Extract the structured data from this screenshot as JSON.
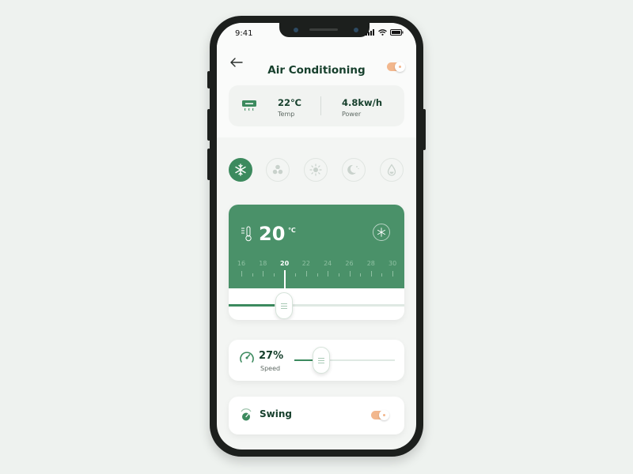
{
  "status_bar": {
    "time": "9:41"
  },
  "header": {
    "title": "Air Conditioning",
    "power_toggle": "on"
  },
  "info": {
    "temp_value": "22℃",
    "temp_label": "Temp",
    "power_value": "4.8kw/h",
    "power_label": "Power"
  },
  "modes": [
    {
      "icon": "snowflake-icon",
      "active": true
    },
    {
      "icon": "fan-icon",
      "active": false
    },
    {
      "icon": "sun-icon",
      "active": false
    },
    {
      "icon": "moon-icon",
      "active": false
    },
    {
      "icon": "water-drop-icon",
      "active": false
    }
  ],
  "temperature": {
    "value": "20",
    "unit": "℃",
    "scale": [
      "16",
      "18",
      "20",
      "22",
      "24",
      "26",
      "28",
      "30"
    ],
    "selected": "20"
  },
  "speed": {
    "value": "27%",
    "label": "Speed",
    "level": 0.27
  },
  "swing": {
    "label": "Swing",
    "toggle": "on"
  },
  "colors": {
    "accent": "#3c8a5e",
    "card_green": "#4a9169",
    "toggle": "#f2b78d",
    "text_dark": "#17402d"
  }
}
